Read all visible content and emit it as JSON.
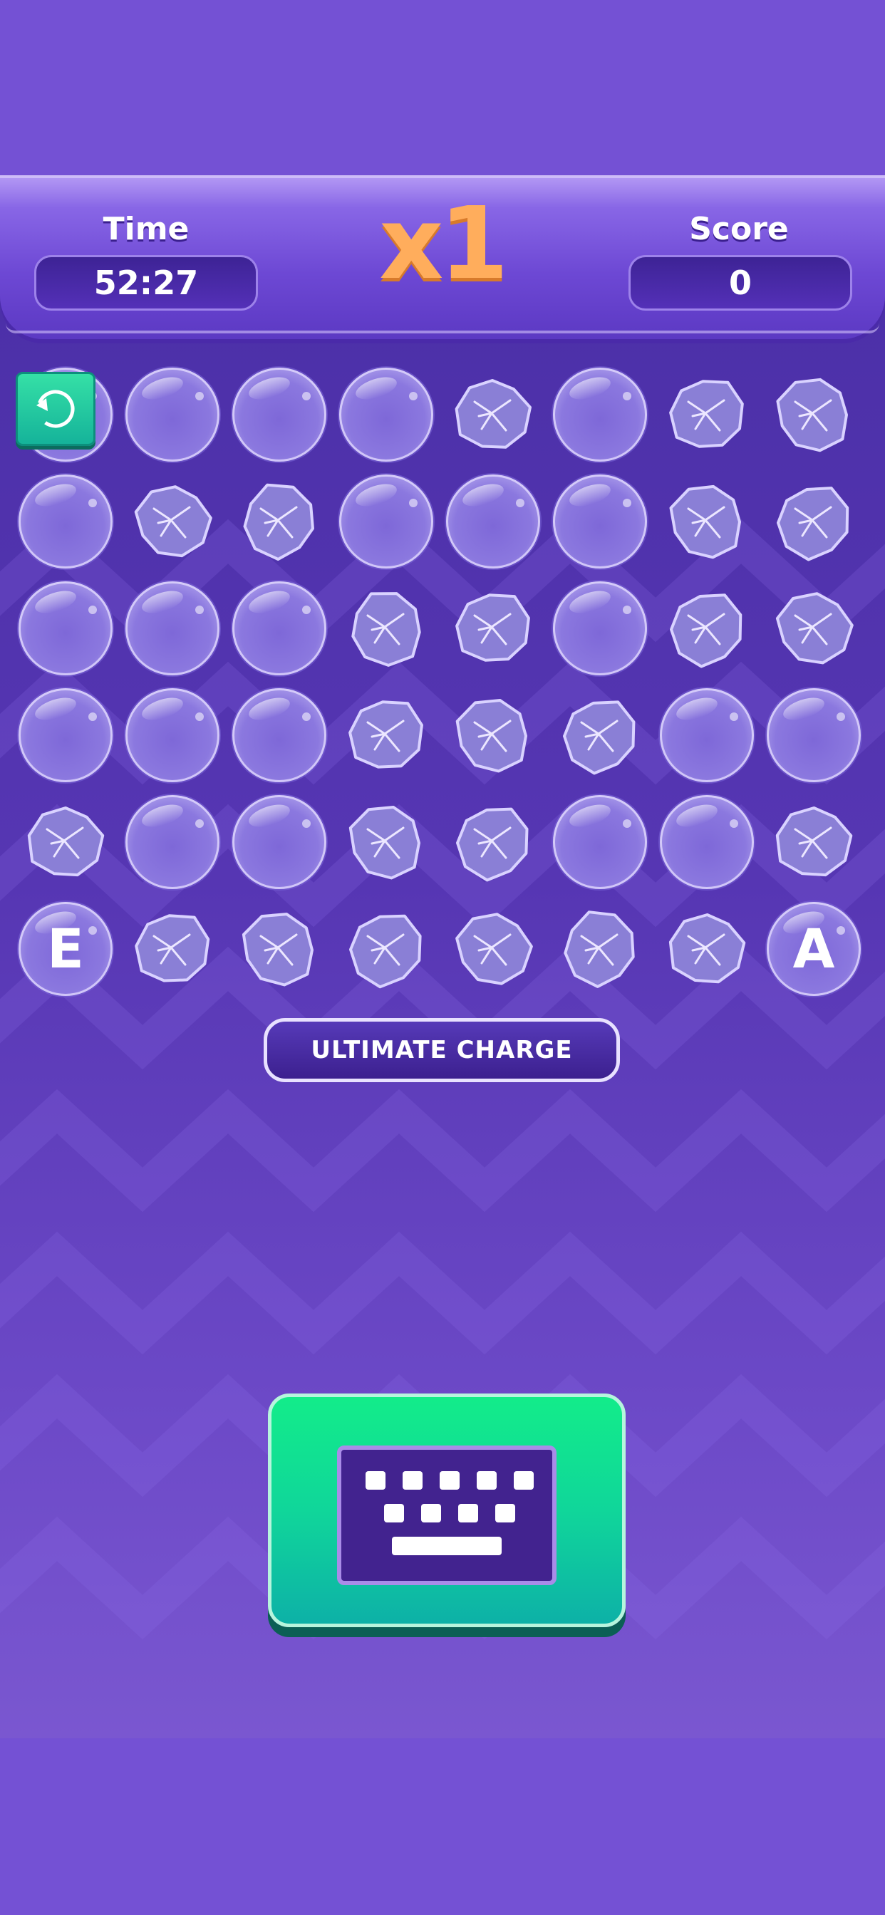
{
  "header": {
    "time_label": "Time",
    "time_value": "52:27",
    "multiplier": "x1",
    "score_label": "Score",
    "score_value": "0"
  },
  "board": {
    "rows": 6,
    "cols": 8,
    "grid": [
      [
        "bubble",
        "bubble",
        "bubble",
        "bubble",
        "rock",
        "bubble",
        "rock",
        "rock"
      ],
      [
        "bubble",
        "rock",
        "rock",
        "bubble",
        "bubble",
        "bubble",
        "rock",
        "rock"
      ],
      [
        "bubble",
        "bubble",
        "bubble",
        "rock",
        "rock",
        "bubble",
        "rock",
        "rock"
      ],
      [
        "bubble",
        "bubble",
        "bubble",
        "rock",
        "rock",
        "rock",
        "bubble",
        "bubble"
      ],
      [
        "rock",
        "bubble",
        "bubble",
        "rock",
        "rock",
        "bubble",
        "bubble",
        "rock"
      ],
      [
        "bubble:E",
        "rock",
        "rock",
        "rock",
        "rock",
        "rock",
        "rock",
        "bubble:A"
      ]
    ]
  },
  "buttons": {
    "undo_icon": "undo-icon",
    "ultimate_label": "ULTIMATE CHARGE",
    "keyboard_icon": "keyboard-icon"
  },
  "colors": {
    "background": "#7451d4",
    "multiplier": "#ffad5c",
    "keyboard_button": "#10d69a",
    "undo_button": "#22c9a0"
  }
}
